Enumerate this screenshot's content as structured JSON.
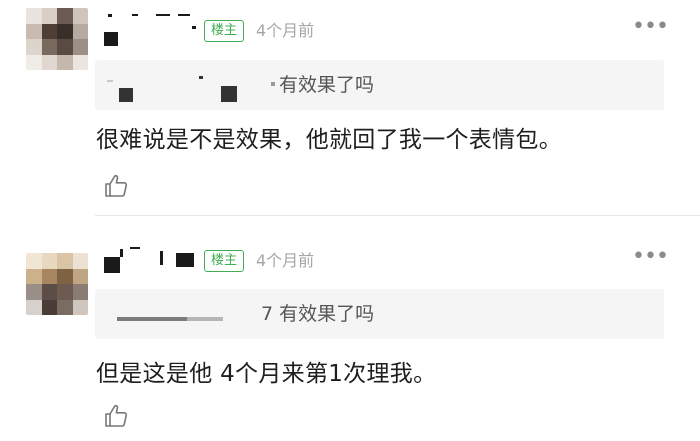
{
  "comments": [
    {
      "badge": "楼主",
      "time": "4个月前",
      "more": "•••",
      "quote": "有效果了吗",
      "text": "很难说是不是效果，他就回了我一个表情包。"
    },
    {
      "badge": "楼主",
      "time": "4个月前",
      "more": "•••",
      "quote": "7 有效果了吗",
      "text": "但是这是他 4个月来第1次理我。"
    }
  ]
}
